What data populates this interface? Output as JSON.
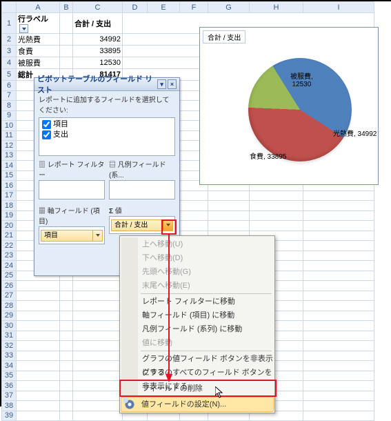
{
  "columns": [
    "A",
    "B",
    "C",
    "D",
    "E",
    "F",
    "G",
    "H",
    "I"
  ],
  "pivot": {
    "row_label_header": "行ラベル",
    "value_header": "合計 / 支出",
    "rows": [
      {
        "label": "光熱費",
        "value": "34992"
      },
      {
        "label": "食費",
        "value": "33895"
      },
      {
        "label": "被服費",
        "value": "12530"
      }
    ],
    "total_label": "総計",
    "total_value": "81417"
  },
  "fieldlist": {
    "title": "ピボットテーブルのフィールド リスト",
    "subtitle": "レポートに追加するフィールドを選択してください:",
    "fields": [
      "項目",
      "支出"
    ],
    "zone_filter_label": "レポート フィルター",
    "zone_legend_label": "凡例フィールド (系...",
    "zone_axis_label": "軸フィールド (項目)",
    "zone_axis_item": "項目",
    "zone_values_label": "値",
    "zone_values_item": "合計 / 支出"
  },
  "menu": {
    "items": [
      {
        "key": "up",
        "label": "上へ移動(U)",
        "disabled": true
      },
      {
        "key": "down",
        "label": "下へ移動(D)",
        "disabled": true
      },
      {
        "key": "begin",
        "label": "先頭へ移動(G)",
        "disabled": true
      },
      {
        "key": "end",
        "label": "末尾へ移動(E)",
        "disabled": true
      },
      {
        "sep": true
      },
      {
        "key": "to-filter",
        "label": "レポート フィルターに移動"
      },
      {
        "key": "to-axis",
        "label": "軸フィールド (項目) に移動"
      },
      {
        "key": "to-legend",
        "label": "凡例フィールド (系列) に移動"
      },
      {
        "key": "to-values",
        "label": "値に移動",
        "disabled": true
      },
      {
        "sep": true
      },
      {
        "key": "hide-chart-btn",
        "label": "グラフの値フィールド ボタンを非表示にする"
      },
      {
        "key": "hide-all-btn",
        "label": "グラフのすべてのフィールド ボタンを非表示にする"
      },
      {
        "sep": true
      },
      {
        "key": "remove",
        "label": "フィールドの削除"
      },
      {
        "sep": true
      },
      {
        "key": "settings",
        "label": "値フィールドの設定(N)...",
        "hover": true,
        "icon": "cog"
      }
    ]
  },
  "chart_data": {
    "type": "pie",
    "title": "合計 / 支出",
    "series": [
      {
        "name": "光熱費",
        "value": 34992,
        "color": "#4f81bd"
      },
      {
        "name": "食費",
        "value": 33895,
        "color": "#c0504d"
      },
      {
        "name": "被服費",
        "value": 12530,
        "color": "#9bbb59"
      }
    ],
    "labels": [
      {
        "text": "光熱費, 34992"
      },
      {
        "text": "食費, 33895"
      },
      {
        "text": "被服費, 12530"
      }
    ]
  }
}
